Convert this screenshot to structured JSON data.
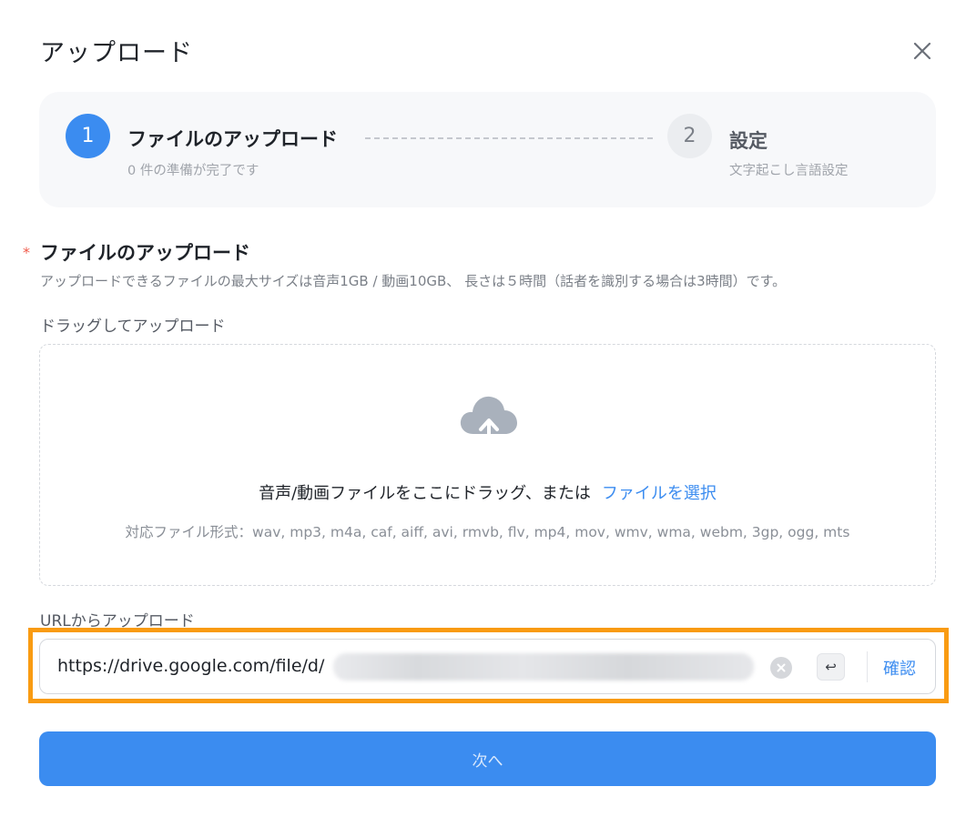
{
  "dialog": {
    "title": "アップロード",
    "close_icon": "close-icon"
  },
  "steps": [
    {
      "number": "1",
      "title": "ファイルのアップロード",
      "subtitle": "0 件の準備が完了です",
      "state": "active"
    },
    {
      "number": "2",
      "title": "設定",
      "subtitle": "文字起こし言語設定",
      "state": "inactive"
    }
  ],
  "upload_section": {
    "required_mark": "*",
    "title": "ファイルのアップロード",
    "description": "アップロードできるファイルの最大サイズは音声1GB / 動画10GB、 長さは５時間（話者を識別する場合は3時間）です。"
  },
  "dropzone": {
    "label": "ドラッグしてアップロード",
    "icon": "cloud-upload-icon",
    "text": "音声/動画ファイルをここにドラッグ、または",
    "select_link": "ファイルを選択",
    "formats": "対応ファイル形式：wav, mp3, m4a, caf, aiff, avi, rmvb, flv, mp4, mov, wmv, wma, webm, 3gp, ogg, mts"
  },
  "url_upload": {
    "label": "URLからアップロード",
    "value": "https://drive.google.com/file/d/",
    "enter_key": "↩",
    "confirm_label": "確認"
  },
  "next_button": "次へ",
  "colors": {
    "accent": "#3b8cf0",
    "highlight": "#f99b12",
    "required": "#f05a4a"
  }
}
